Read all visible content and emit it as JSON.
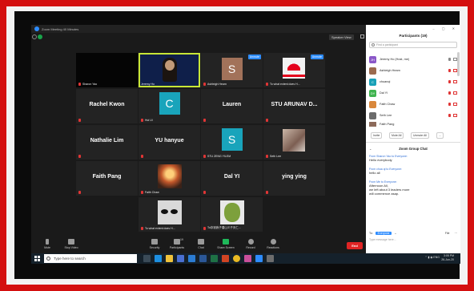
{
  "window": {
    "title": "Zoom Meeting 40 Minutes"
  },
  "header": {
    "view_label": "Speaker View"
  },
  "tiles": [
    {
      "id": "t1",
      "caption": "Sharon Yao"
    },
    {
      "id": "t2",
      "caption": "Jeremy Ho"
    },
    {
      "id": "t3",
      "letter": "S",
      "caption": "Ashleigh Hearn",
      "unmute": "Unmute"
    },
    {
      "id": "t4",
      "caption": "To what extent does H...",
      "unmute": "Unmute"
    },
    {
      "id": "t5",
      "name": "Rachel Kwon"
    },
    {
      "id": "t6",
      "letter": "C",
      "caption": "Hui Ui"
    },
    {
      "id": "t7",
      "name": "Lauren"
    },
    {
      "id": "t8",
      "name": "STU ARUNAV D..."
    },
    {
      "id": "t9",
      "name": "Nathalie Lim"
    },
    {
      "id": "t10",
      "name": "YU hanyue"
    },
    {
      "id": "t11",
      "letter": "S",
      "caption": "STU ZENG YILEM"
    },
    {
      "id": "t12",
      "caption": "Seth Lee"
    },
    {
      "id": "t13",
      "name": "Faith Pang"
    },
    {
      "id": "t14",
      "caption": "Faith Chaw"
    },
    {
      "id": "t15",
      "name": "Dal YI"
    },
    {
      "id": "t16",
      "name": "ying ying"
    },
    {
      "id": "t17",
      "caption": "To what extent does H..."
    },
    {
      "id": "t18",
      "caption": "To存钱我子潜山义子天仁..."
    }
  ],
  "toolbar": {
    "mute": "Mute",
    "stop_video": "Stop Video",
    "security": "Security",
    "participants": "Participants",
    "participants_count": "19",
    "chat": "Chat",
    "share_screen": "Share Screen",
    "record": "Record",
    "reactions": "Reactions",
    "end": "End"
  },
  "panel": {
    "title": "Participants (19)",
    "search_placeholder": "Find a participant",
    "participants": [
      {
        "initials": "JH",
        "name": "Jeremy Ho (Host, me)",
        "color": "#8a57c8"
      },
      {
        "initials": "",
        "name": "Ashleigh Hearn",
        "color": "#9b6a4e"
      },
      {
        "initials": "C",
        "name": "chuanqi",
        "color": "#18a1b8"
      },
      {
        "initials": "DY",
        "name": "Dal YI",
        "color": "#3fb34f"
      },
      {
        "initials": "",
        "name": "Faith Chaw",
        "color": "#d9873b"
      },
      {
        "initials": "",
        "name": "Seth Lee",
        "color": "#6b6b6b"
      },
      {
        "initials": "",
        "name": "Faith Pang",
        "color": "#8c6a5a"
      }
    ],
    "invite": "Invite",
    "mute_all": "Mute All",
    "unmute_all": "Unmute All",
    "more": "...",
    "chat_title": "Zoom Group Chat",
    "messages": [
      {
        "from": "From Sharon Yao to Everyone:",
        "text": "Hello everybody"
      },
      {
        "from": "From chua qi to Everyone:",
        "text": "hello all"
      },
      {
        "from": "From Me to Everyone:",
        "text": "Afternoon All,\nwe left about 3 leaders more\nwill commence asap."
      }
    ],
    "to_label": "To:",
    "to_value": "Everyone",
    "file_label": "File",
    "type_placeholder": "Type message here..."
  },
  "taskbar": {
    "search": "Type here to search",
    "tray_lang": "ENG",
    "time": "3:05 PM",
    "date": "26-Jun-20"
  }
}
